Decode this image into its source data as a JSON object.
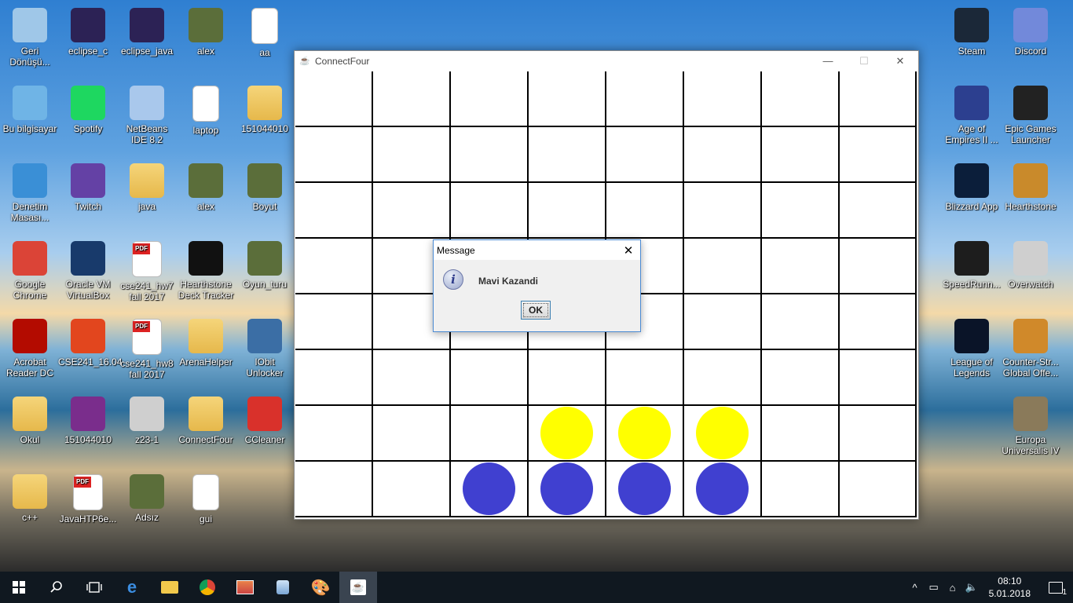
{
  "desktop": {
    "icons": [
      {
        "label": "Geri Dönüşü...",
        "icon": "recycle-bin-icon"
      },
      {
        "label": "eclipse_c",
        "icon": "eclipse-icon"
      },
      {
        "label": "eclipse_java",
        "icon": "eclipse-icon"
      },
      {
        "label": "alex",
        "icon": "image-icon"
      },
      {
        "label": "aa",
        "icon": "document-icon"
      },
      {
        "label": "Bu bilgisayar",
        "icon": "computer-icon"
      },
      {
        "label": "Spotify",
        "icon": "spotify-icon"
      },
      {
        "label": "NetBeans IDE 8.2",
        "icon": "netbeans-icon"
      },
      {
        "label": "laptop",
        "icon": "document-icon"
      },
      {
        "label": "151044010",
        "icon": "folder-icon"
      },
      {
        "label": "Denetim Masası...",
        "icon": "control-panel-icon"
      },
      {
        "label": "Twitch",
        "icon": "twitch-icon"
      },
      {
        "label": "java",
        "icon": "folder-icon"
      },
      {
        "label": "alex",
        "icon": "image-icon"
      },
      {
        "label": "Boyut",
        "icon": "image-icon"
      },
      {
        "label": "Google Chrome",
        "icon": "chrome-icon"
      },
      {
        "label": "Oracle VM VirtualBox",
        "icon": "virtualbox-icon"
      },
      {
        "label": "cse241_hw7 fall 2017",
        "icon": "pdf-icon"
      },
      {
        "label": "Hearthstone Deck Tracker",
        "icon": "deck-tracker-icon"
      },
      {
        "label": "Oyun_turu",
        "icon": "image-icon"
      },
      {
        "label": "Acrobat Reader DC",
        "icon": "acrobat-icon"
      },
      {
        "label": "CSE241_16.04",
        "icon": "vdi-icon"
      },
      {
        "label": "cse241_hw8 fall 2017",
        "icon": "pdf-icon"
      },
      {
        "label": "ArenaHelper",
        "icon": "folder-icon"
      },
      {
        "label": "IObit Unlocker",
        "icon": "unlocker-icon"
      },
      {
        "label": "Okul",
        "icon": "folder-icon"
      },
      {
        "label": "151044010",
        "icon": "winrar-icon"
      },
      {
        "label": "z23-1",
        "icon": "file-icon"
      },
      {
        "label": "ConnectFour",
        "icon": "folder-icon"
      },
      {
        "label": "CCleaner",
        "icon": "ccleaner-icon"
      },
      {
        "label": "c++",
        "icon": "folder-icon"
      },
      {
        "label": "JavaHTP6e...",
        "icon": "pdf-icon"
      },
      {
        "label": "Adsız",
        "icon": "image-icon"
      },
      {
        "label": "gui",
        "icon": "document-icon"
      },
      {
        "label": "Steam",
        "icon": "steam-icon"
      },
      {
        "label": "Discord",
        "icon": "discord-icon"
      },
      {
        "label": "Age of Empires II ...",
        "icon": "aoe-icon"
      },
      {
        "label": "Epic Games Launcher",
        "icon": "epic-icon"
      },
      {
        "label": "Blizzard App",
        "icon": "blizzard-icon"
      },
      {
        "label": "Hearthstone",
        "icon": "hearthstone-icon"
      },
      {
        "label": "SpeedRunn...",
        "icon": "speedrunners-icon"
      },
      {
        "label": "Overwatch",
        "icon": "overwatch-icon"
      },
      {
        "label": "League of Legends",
        "icon": "lol-icon"
      },
      {
        "label": "Counter-Str... Global Offe...",
        "icon": "csgo-icon"
      },
      {
        "label": "Europa Universalis IV",
        "icon": "eu4-icon"
      }
    ]
  },
  "window": {
    "title": "ConnectFour",
    "minimize": "—",
    "maximize": "☐",
    "close": "✕"
  },
  "board": {
    "rows": 8,
    "cols": 8,
    "colors": {
      "yellow": "#ffff00",
      "blue": "#4040d0"
    },
    "discs": [
      {
        "row": 6,
        "col": 3,
        "color": "yellow"
      },
      {
        "row": 6,
        "col": 4,
        "color": "yellow"
      },
      {
        "row": 6,
        "col": 5,
        "color": "yellow"
      },
      {
        "row": 7,
        "col": 2,
        "color": "blue"
      },
      {
        "row": 7,
        "col": 3,
        "color": "blue"
      },
      {
        "row": 7,
        "col": 4,
        "color": "blue"
      },
      {
        "row": 7,
        "col": 5,
        "color": "blue"
      }
    ]
  },
  "dialog": {
    "title": "Message",
    "close": "✕",
    "info_glyph": "i",
    "message": "Mavi Kazandi",
    "ok_label": "OK"
  },
  "taskbar": {
    "clock_time": "08:10",
    "clock_date": "5.01.2018",
    "notification_count": "1"
  }
}
